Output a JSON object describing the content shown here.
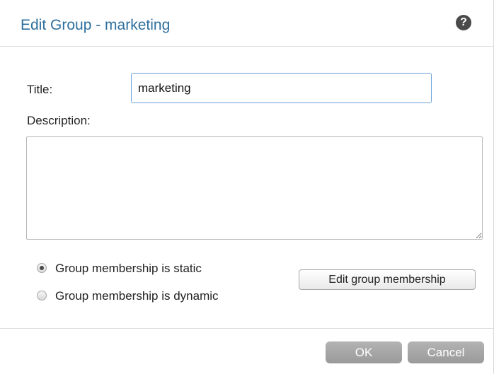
{
  "dialog": {
    "title": "Edit Group - marketing",
    "help_icon": "question-icon",
    "help_glyph": "?"
  },
  "form": {
    "title_label": "Title:",
    "title_value": "marketing",
    "description_label": "Description:",
    "description_value": ""
  },
  "membership": {
    "static_label": "Group membership is static",
    "dynamic_label": "Group membership is dynamic",
    "selected": "static",
    "edit_button_label": "Edit group membership"
  },
  "footer": {
    "ok_label": "OK",
    "cancel_label": "Cancel"
  },
  "colors": {
    "title_blue": "#2e6f9e",
    "button_gray": "#a6a6a6",
    "focus_border": "#6aa3d8"
  }
}
